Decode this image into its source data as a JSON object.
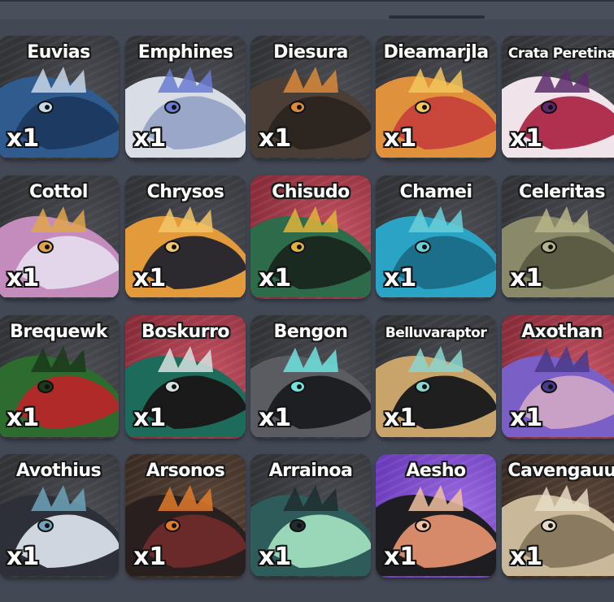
{
  "inventory": {
    "items": [
      {
        "name": "Euvias",
        "qty": "x1",
        "bg": "dark",
        "colors": [
          "#2f5b8f",
          "#1d3a63",
          "#c9d7e6"
        ],
        "icon": "blue-shark-creature-icon"
      },
      {
        "name": "Emphines",
        "qty": "x1",
        "bg": "dark",
        "colors": [
          "#d8dde6",
          "#9aa7c8",
          "#6b7bd1"
        ],
        "icon": "white-wolf-creature-icon"
      },
      {
        "name": "Diesura",
        "qty": "x1",
        "bg": "dark",
        "colors": [
          "#4a3e36",
          "#2c2520",
          "#d98a3a"
        ],
        "icon": "brown-horned-creature-icon"
      },
      {
        "name": "Dieamarjla",
        "qty": "x1",
        "bg": "dark",
        "colors": [
          "#e0913c",
          "#c9463a",
          "#f2c65a"
        ],
        "icon": "orange-frilled-creature-icon"
      },
      {
        "name": "Crata Peretina",
        "qty": "x1",
        "bg": "dark",
        "colors": [
          "#f0e4ea",
          "#b0304f",
          "#5a2a6a"
        ],
        "icon": "pink-spotted-creature-icon"
      },
      {
        "name": "Cottol",
        "qty": "x1",
        "bg": "dark",
        "colors": [
          "#c48bbd",
          "#e4d6ea",
          "#e0a54a"
        ],
        "icon": "pink-fluffy-creature-icon"
      },
      {
        "name": "Chrysos",
        "qty": "x1",
        "bg": "dark",
        "colors": [
          "#e39a3a",
          "#2c2a2e",
          "#f2c56a"
        ],
        "icon": "golden-spiked-creature-icon"
      },
      {
        "name": "Chisudo",
        "qty": "x1",
        "bg": "red",
        "colors": [
          "#2e6b4a",
          "#1b2a20",
          "#e0b43a"
        ],
        "icon": "green-beaked-creature-icon"
      },
      {
        "name": "Chamei",
        "qty": "x1",
        "bg": "dark",
        "colors": [
          "#2aa3c4",
          "#1c6f8a",
          "#6ad0d8"
        ],
        "icon": "teal-frilled-creature-icon"
      },
      {
        "name": "Celeritas",
        "qty": "x1",
        "bg": "dark",
        "colors": [
          "#8a8a6a",
          "#5c5c44",
          "#b6b48a"
        ],
        "icon": "olive-spiked-creature-icon"
      },
      {
        "name": "Brequewk",
        "qty": "x1",
        "bg": "dark",
        "colors": [
          "#2e6b2e",
          "#b02a2a",
          "#1a3a1a"
        ],
        "icon": "green-red-creature-icon"
      },
      {
        "name": "Boskurro",
        "qty": "x1",
        "bg": "red",
        "colors": [
          "#1d6b5a",
          "#1a1a1a",
          "#d7e0e0"
        ],
        "icon": "teal-fanged-creature-icon"
      },
      {
        "name": "Bengon",
        "qty": "x1",
        "bg": "dark",
        "colors": [
          "#5a5c62",
          "#1e1f22",
          "#6fe3e0"
        ],
        "icon": "grey-whiskered-creature-icon"
      },
      {
        "name": "Belluvaraptor",
        "qty": "x1",
        "bg": "dark",
        "colors": [
          "#c9a46a",
          "#1f1f1f",
          "#8ad6cf"
        ],
        "icon": "tan-black-raptor-icon"
      },
      {
        "name": "Axothan",
        "qty": "x1",
        "bg": "red",
        "colors": [
          "#7a5fc6",
          "#c9a0c6",
          "#4a3a8a"
        ],
        "icon": "purple-axolotl-creature-icon"
      },
      {
        "name": "Avothius",
        "qty": "x1",
        "bg": "dark",
        "colors": [
          "#2d3038",
          "#cfd6e0",
          "#6fa2b8"
        ],
        "icon": "dark-feathered-creature-icon"
      },
      {
        "name": "Arsonos",
        "qty": "x1",
        "bg": "brown",
        "colors": [
          "#2a1f1f",
          "#6a2a2a",
          "#e07a2a"
        ],
        "icon": "dark-ember-creature-icon"
      },
      {
        "name": "Arrainoa",
        "qty": "x1",
        "bg": "dark",
        "colors": [
          "#2e5c5a",
          "#9ad6b8",
          "#1e2e30"
        ],
        "icon": "teal-swirl-creature-icon"
      },
      {
        "name": "Aesho",
        "qty": "x1",
        "bg": "purple",
        "colors": [
          "#1e1e22",
          "#d68a6a",
          "#f0c0a0"
        ],
        "icon": "black-striped-creature-icon"
      },
      {
        "name": "Cavengauu",
        "qty": "x1",
        "bg": "brown",
        "colors": [
          "#c9b89a",
          "#8a7a60",
          "#e6dcc6"
        ],
        "icon": "tan-duo-creature-icon"
      }
    ]
  }
}
